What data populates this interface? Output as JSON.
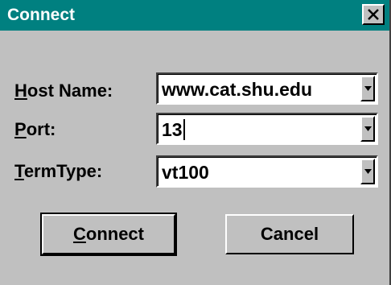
{
  "window": {
    "title": "Connect",
    "close_glyph": "X"
  },
  "fields": {
    "host": {
      "label_accel": "H",
      "label_rest": "ost Name:",
      "value": "www.cat.shu.edu"
    },
    "port": {
      "label_accel": "P",
      "label_rest": "ort:",
      "value": "13"
    },
    "termtype": {
      "label_accel": "T",
      "label_rest": "ermType:",
      "value": "vt100"
    }
  },
  "buttons": {
    "connect": {
      "label_accel": "C",
      "label_rest": "onnect"
    },
    "cancel": {
      "label": "Cancel"
    }
  },
  "colors": {
    "titlebar": "#008080",
    "dialog_bg": "#c0c0c0",
    "field_bg": "#ffffff"
  },
  "icons": {
    "close": "close-icon",
    "dropdown": "chevron-down-icon"
  }
}
